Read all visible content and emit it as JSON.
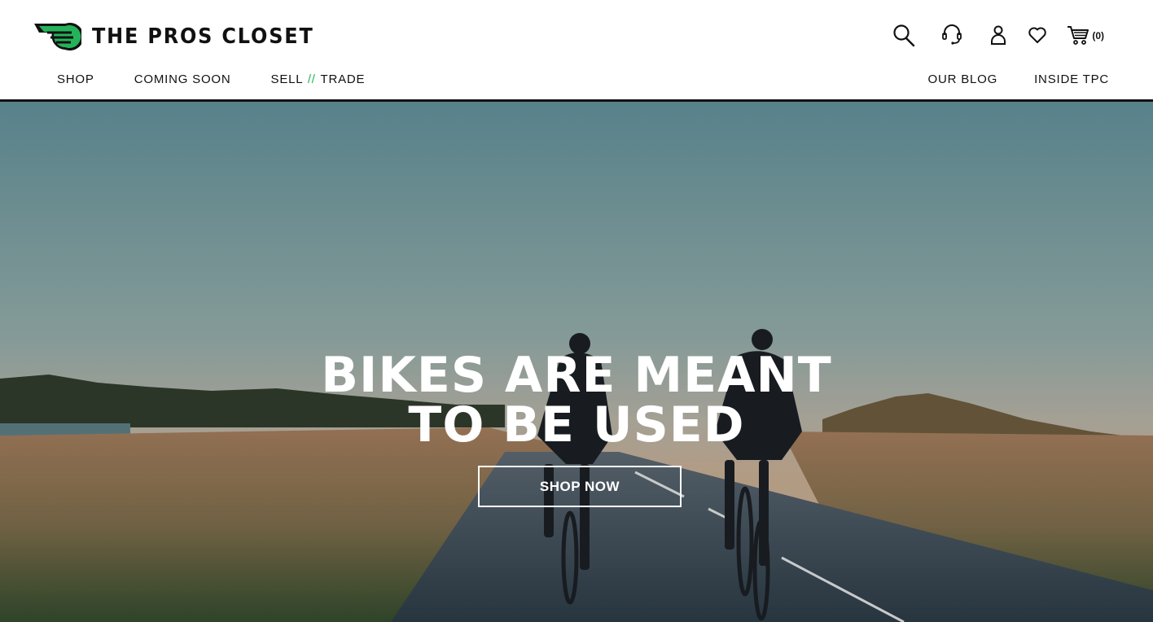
{
  "header": {
    "logo_text": "THE PROS CLOSET",
    "icons": [
      "search-icon",
      "support-headset-icon",
      "account-icon",
      "heart-icon",
      "cart-icon"
    ],
    "cart_count": "(0)"
  },
  "nav": {
    "primary": {
      "shop": "SHOP",
      "coming_soon": "COMING SOON",
      "sell": "SELL",
      "sell_sep": "//",
      "trade": "TRADE"
    },
    "secondary": {
      "blog": "OUR BLOG",
      "inside": "INSIDE TPC"
    }
  },
  "hero": {
    "headline_line1": "BIKES ARE MEANT",
    "headline_line2": "TO BE USED",
    "cta_label": "SHOP NOW"
  },
  "colors": {
    "brand_green": "#25b35a",
    "text": "#111111",
    "hero_text": "#ffffff"
  }
}
